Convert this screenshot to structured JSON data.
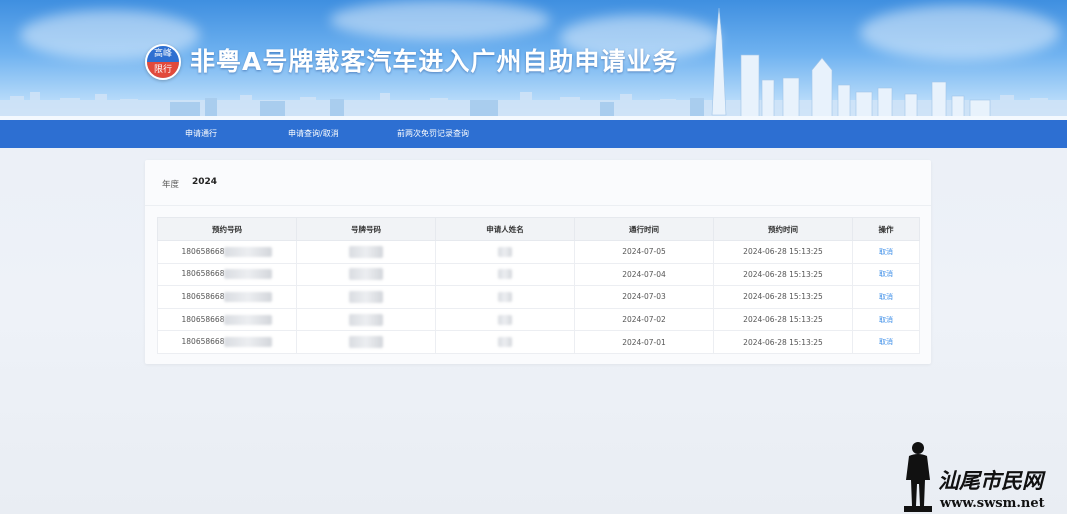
{
  "header": {
    "badge_top": "高峰",
    "badge_bottom": "限行",
    "title": "非粤A号牌载客汽车进入广州自助申请业务"
  },
  "nav": {
    "items": [
      {
        "label": "申请通行"
      },
      {
        "label": "申请查询/取消"
      },
      {
        "label": "前两次免罚记录查询"
      }
    ]
  },
  "filter": {
    "year_label": "年度",
    "year_value": "2024"
  },
  "table": {
    "columns": [
      "预约号码",
      "号牌号码",
      "申请人姓名",
      "通行时间",
      "预约时间",
      "操作"
    ],
    "rows": [
      {
        "reservation_no": "180658668",
        "pass_date": "2024-07-05",
        "booked_at": "2024-06-28 15:13:25",
        "action": "取消"
      },
      {
        "reservation_no": "180658668",
        "pass_date": "2024-07-04",
        "booked_at": "2024-06-28 15:13:25",
        "action": "取消"
      },
      {
        "reservation_no": "180658668",
        "pass_date": "2024-07-03",
        "booked_at": "2024-06-28 15:13:25",
        "action": "取消"
      },
      {
        "reservation_no": "180658668",
        "pass_date": "2024-07-02",
        "booked_at": "2024-06-28 15:13:25",
        "action": "取消"
      },
      {
        "reservation_no": "180658668",
        "pass_date": "2024-07-01",
        "booked_at": "2024-06-28 15:13:25",
        "action": "取消"
      }
    ]
  },
  "watermark": {
    "brand": "汕尾市民网",
    "url": "www.swsm.net"
  },
  "colors": {
    "nav_bg": "#2d6fd2",
    "link": "#3d8ee8",
    "badge_blue": "#2e6fd1",
    "badge_red": "#e24a3b"
  }
}
